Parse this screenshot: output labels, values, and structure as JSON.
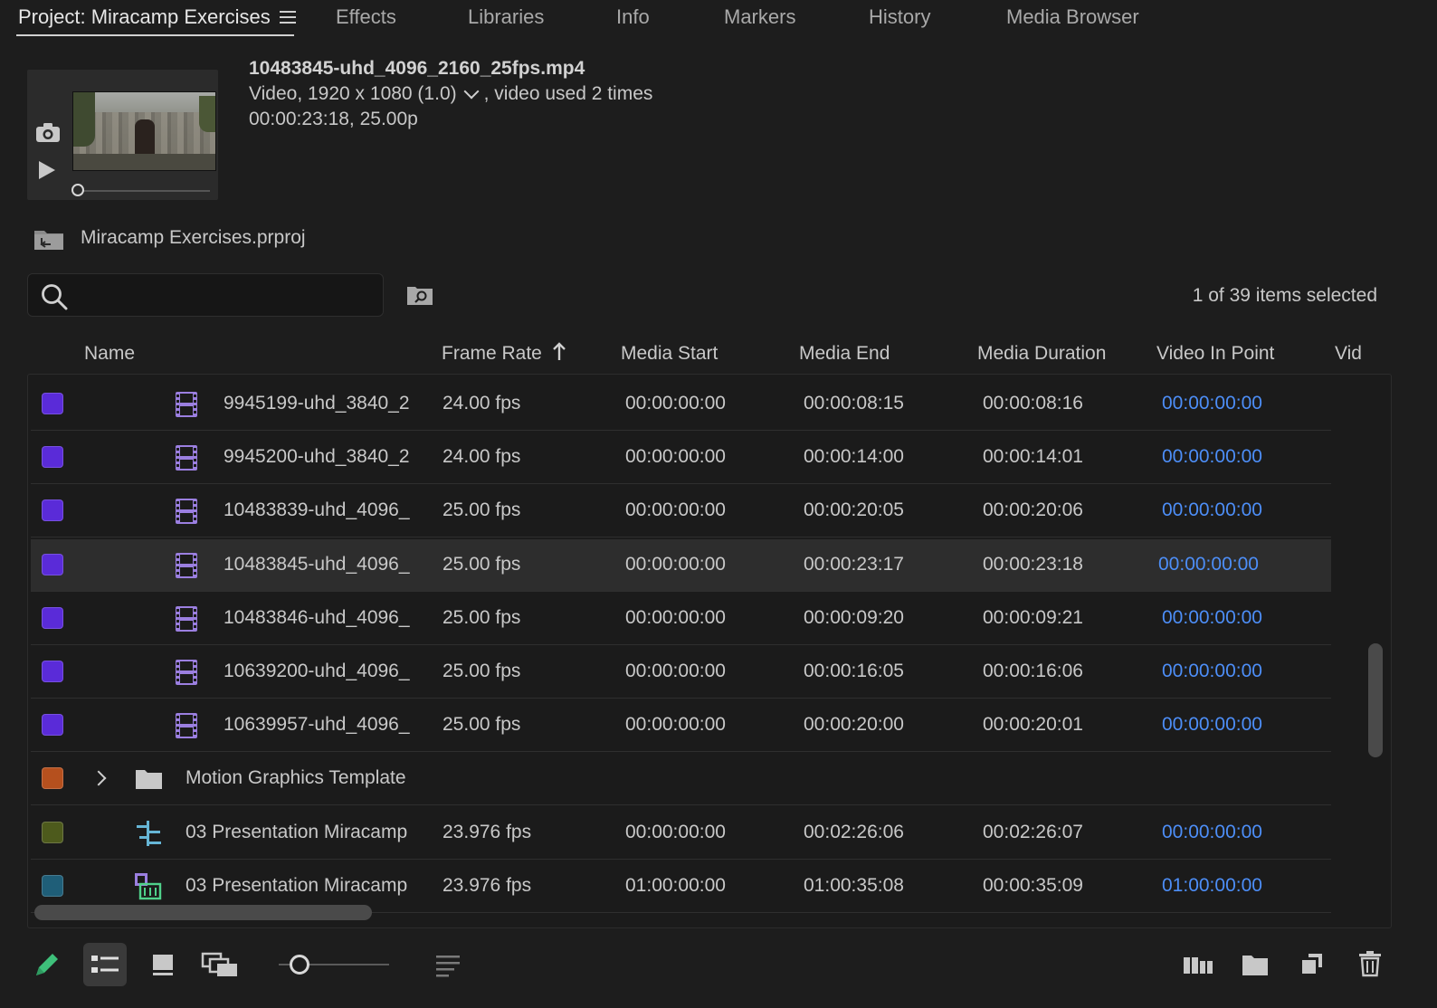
{
  "tabs": [
    {
      "label": "Project: Miracamp Exercises",
      "active": true
    },
    {
      "label": "Effects"
    },
    {
      "label": "Libraries"
    },
    {
      "label": "Info"
    },
    {
      "label": "Markers"
    },
    {
      "label": "History"
    },
    {
      "label": "Media Browser"
    }
  ],
  "clip": {
    "name": "10483845-uhd_4096_2160_25fps.mp4",
    "video_info": "Video, 1920 x 1080 (1.0)",
    "usage": ", video used 2 times",
    "timing": "00:00:23:18, 25.00p"
  },
  "project": {
    "file": "Miracamp Exercises.prproj"
  },
  "search": {
    "placeholder": "",
    "value": ""
  },
  "selection_count": "1 of 39 items selected",
  "columns": [
    "Name",
    "Frame Rate",
    "Media Start",
    "Media End",
    "Media Duration",
    "Video In Point",
    "Vid"
  ],
  "rows": [
    {
      "color": "#5a2bd8",
      "type": "clip",
      "name": "9945199-uhd_3840_2",
      "frame_rate": "24.00 fps",
      "media_start": "00:00:00:00",
      "media_end": "00:00:08:15",
      "duration": "00:00:08:16",
      "video_in": "00:00:00:00"
    },
    {
      "color": "#5a2bd8",
      "type": "clip",
      "name": "9945200-uhd_3840_2",
      "frame_rate": "24.00 fps",
      "media_start": "00:00:00:00",
      "media_end": "00:00:14:00",
      "duration": "00:00:14:01",
      "video_in": "00:00:00:00"
    },
    {
      "color": "#5a2bd8",
      "type": "clip",
      "name": "10483839-uhd_4096_",
      "frame_rate": "25.00 fps",
      "media_start": "00:00:00:00",
      "media_end": "00:00:20:05",
      "duration": "00:00:20:06",
      "video_in": "00:00:00:00"
    },
    {
      "color": "#5a2bd8",
      "type": "clip",
      "name": "10483845-uhd_4096_",
      "frame_rate": "25.00 fps",
      "media_start": "00:00:00:00",
      "media_end": "00:00:23:17",
      "duration": "00:00:23:18",
      "video_in": "00:00:00:00",
      "selected": true
    },
    {
      "color": "#5a2bd8",
      "type": "clip",
      "name": "10483846-uhd_4096_",
      "frame_rate": "25.00 fps",
      "media_start": "00:00:00:00",
      "media_end": "00:00:09:20",
      "duration": "00:00:09:21",
      "video_in": "00:00:00:00"
    },
    {
      "color": "#5a2bd8",
      "type": "clip",
      "name": "10639200-uhd_4096_",
      "frame_rate": "25.00 fps",
      "media_start": "00:00:00:00",
      "media_end": "00:00:16:05",
      "duration": "00:00:16:06",
      "video_in": "00:00:00:00"
    },
    {
      "color": "#5a2bd8",
      "type": "clip",
      "name": "10639957-uhd_4096_",
      "frame_rate": "25.00 fps",
      "media_start": "00:00:00:00",
      "media_end": "00:00:20:00",
      "duration": "00:00:20:01",
      "video_in": "00:00:00:00"
    },
    {
      "color": "#b5501e",
      "type": "bin",
      "name": "Motion Graphics Template",
      "frame_rate": "",
      "media_start": "",
      "media_end": "",
      "duration": "",
      "video_in": ""
    },
    {
      "color": "#4d5a1c",
      "type": "mogrt",
      "name": "03 Presentation Miracamp",
      "frame_rate": "23.976 fps",
      "media_start": "00:00:00:00",
      "media_end": "00:02:26:06",
      "duration": "00:02:26:07",
      "video_in": "00:00:00:00"
    },
    {
      "color": "#1f5e78",
      "type": "sequence",
      "name": "03 Presentation Miracamp",
      "frame_rate": "23.976 fps",
      "media_start": "01:00:00:00",
      "media_end": "01:00:35:08",
      "duration": "00:00:35:09",
      "video_in": "01:00:00:00"
    }
  ],
  "icons": {
    "menu": "hamburger-menu-icon",
    "camera": "camera-icon",
    "play": "play-icon",
    "project": "project-folder-icon",
    "search": "search-icon",
    "find": "find-icon",
    "sort": "sort-ascending-icon",
    "toolbar": [
      "pencil-icon",
      "list-view-icon",
      "icon-view-icon",
      "freeform-view-icon",
      "zoom-slider",
      "sort-icons-icon",
      "automate-to-sequence-icon",
      "new-bin-icon",
      "new-item-icon",
      "clear-icon"
    ]
  },
  "colors": {
    "accent_link": "#4d8ef7",
    "selected_row": "#2d2d2d",
    "pencil": "#3ec07a"
  }
}
